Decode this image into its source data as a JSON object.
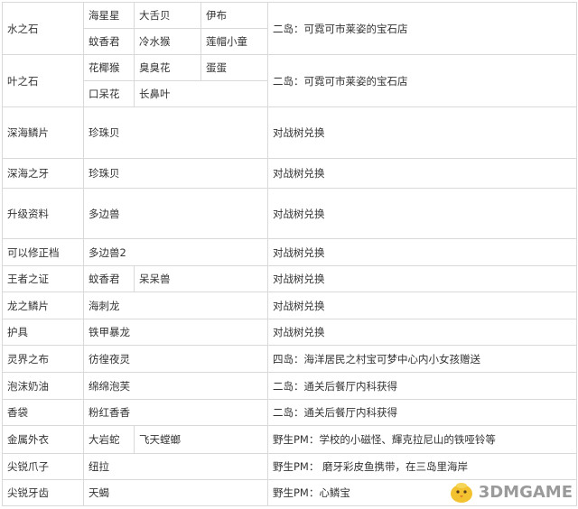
{
  "rows": {
    "r0": {
      "item": "水之石",
      "p": [
        "海星星",
        "大舌贝",
        "伊布"
      ],
      "q": [
        "蚊香君",
        "冷水猴",
        "莲帽小童"
      ],
      "where": "二岛：可霓可市莱姿的宝石店"
    },
    "r1": {
      "item": "叶之石",
      "p": [
        "花椰猴",
        "臭臭花",
        "蛋蛋"
      ],
      "q": [
        "口呆花",
        "长鼻叶"
      ],
      "where": "二岛：可霓可市莱姿的宝石店"
    },
    "r2": {
      "item": "深海鳞片",
      "pokemon": "珍珠贝",
      "where": "对战树兑换"
    },
    "r3": {
      "item": "深海之牙",
      "pokemon": "珍珠贝",
      "where": "对战树兑换"
    },
    "r4": {
      "item": "升级资料",
      "pokemon": "多边兽",
      "where": "对战树兑换"
    },
    "r5": {
      "item": "可以修正档",
      "pokemon": "多边兽2",
      "where": "对战树兑换"
    },
    "r6": {
      "item": "王者之证",
      "p": [
        "蚊香君",
        "呆呆兽"
      ],
      "where": "对战树兑换"
    },
    "r7": {
      "item": "龙之鳞片",
      "pokemon": "海刺龙",
      "where": "对战树兑换"
    },
    "r8": {
      "item": "护具",
      "pokemon": "铁甲暴龙",
      "where": "对战树兑换"
    },
    "r9": {
      "item": "灵界之布",
      "pokemon": "彷徨夜灵",
      "where": "四岛：海洋居民之村宝可梦中心内小女孩赠送"
    },
    "r10": {
      "item": "泡沫奶油",
      "pokemon": "绵绵泡芙",
      "where": "二岛：通关后餐厅内科获得"
    },
    "r11": {
      "item": "香袋",
      "pokemon": "粉红香香",
      "where": "二岛：通关后餐厅内科获得"
    },
    "r12": {
      "item": "金属外衣",
      "p": [
        "大岩蛇",
        "飞天螳螂"
      ],
      "where": "野生PM：学校的小磁怪、輝克拉尼山的铁哑铃等"
    },
    "r13": {
      "item": "尖锐爪子",
      "pokemon": "纽拉",
      "where": "野生PM： 磨牙彩皮鱼携带，在三岛里海岸"
    },
    "r14": {
      "item": "尖锐牙齿",
      "pokemon": "天蝎",
      "where": "野生PM：心鳞宝"
    }
  },
  "watermark": {
    "text": "3DMGAME",
    "logo_icon": "chick-mascot-icon",
    "color": "#9a9a9a"
  },
  "colors": {
    "border": "#d9d9d9",
    "text": "#333333"
  }
}
